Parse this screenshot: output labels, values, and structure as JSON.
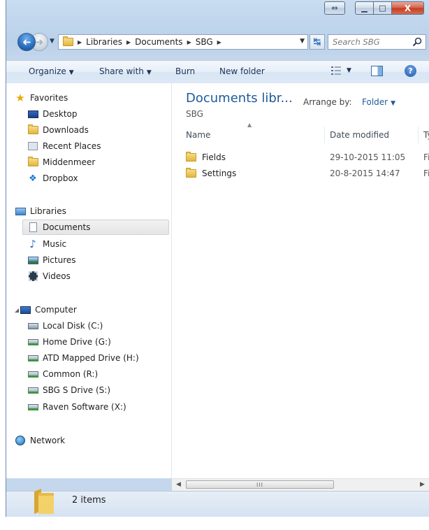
{
  "window": {
    "caption": {
      "snap_symbol": "⇔",
      "minimize_symbol": "▁",
      "maximize_symbol": "□",
      "close_symbol": "X"
    }
  },
  "address": {
    "crumbs": [
      "Libraries",
      "Documents",
      "SBG"
    ],
    "separator": "▶"
  },
  "search": {
    "placeholder": "Search SBG"
  },
  "toolbar": {
    "organize": "Organize",
    "share_with": "Share with",
    "burn": "Burn",
    "new_folder": "New folder"
  },
  "nav_pane": {
    "favorites": {
      "label": "Favorites",
      "items": [
        "Desktop",
        "Downloads",
        "Recent Places",
        "Middenmeer",
        "Dropbox"
      ]
    },
    "libraries": {
      "label": "Libraries",
      "items": [
        "Documents",
        "Music",
        "Pictures",
        "Videos"
      ],
      "selected": "Documents"
    },
    "computer": {
      "label": "Computer",
      "items": [
        "Local Disk (C:)",
        "Home Drive (G:)",
        "ATD Mapped Drive (H:)",
        "Common (R:)",
        "SBG S Drive (S:)",
        "Raven Software (X:)"
      ]
    },
    "network": {
      "label": "Network"
    }
  },
  "content": {
    "title": "Documents libr...",
    "subtitle": "SBG",
    "arrange_label": "Arrange by:",
    "arrange_value": "Folder",
    "columns": {
      "name": "Name",
      "date": "Date modified",
      "type": "Ty"
    },
    "rows": [
      {
        "name": "Fields",
        "date": "29-10-2015 11:05",
        "type": "Fil"
      },
      {
        "name": "Settings",
        "date": "20-8-2015 14:47",
        "type": "Fil"
      }
    ]
  },
  "scrollbar": {
    "thumb_grip": "III"
  },
  "details": {
    "item_count": "2 items"
  },
  "colors": {
    "accent": "#1e5a9a",
    "folder": "#e3b63d",
    "close_button": "#c23b22"
  }
}
